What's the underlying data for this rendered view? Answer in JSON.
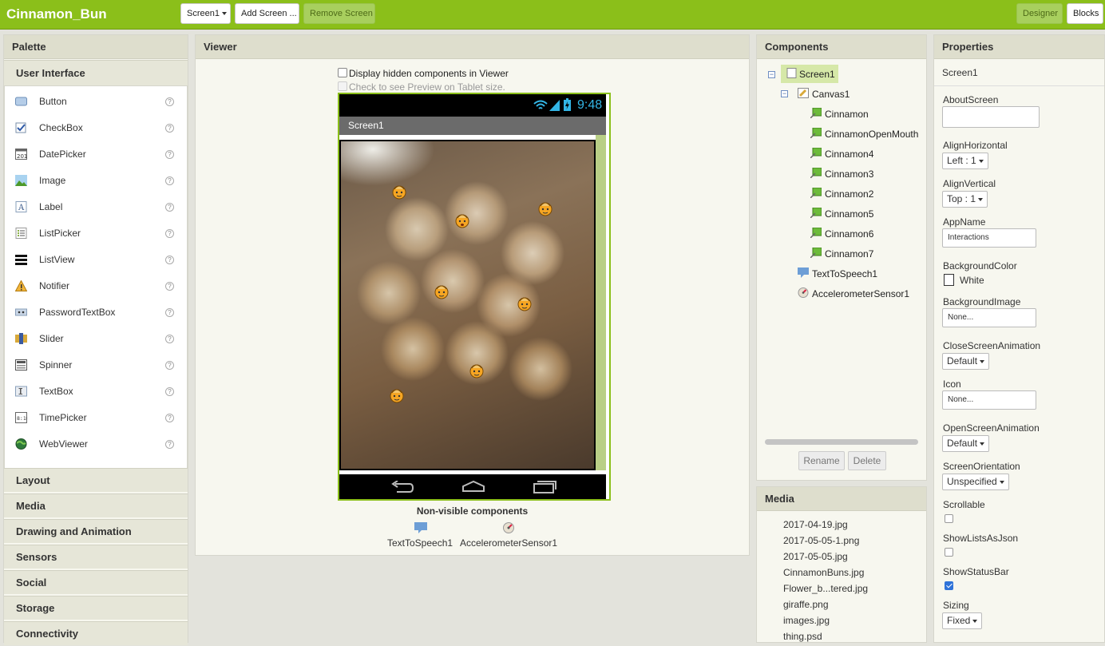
{
  "app_title": "Cinnamon_Bun",
  "toolbar": {
    "screen_select": "Screen1",
    "add_screen": "Add Screen ...",
    "remove_screen": "Remove Screen",
    "designer": "Designer",
    "blocks": "Blocks"
  },
  "palette": {
    "title": "Palette",
    "open_category": "User Interface",
    "items": [
      {
        "label": "Button",
        "icon": "button-icon"
      },
      {
        "label": "CheckBox",
        "icon": "checkbox-icon"
      },
      {
        "label": "DatePicker",
        "icon": "datepicker-icon"
      },
      {
        "label": "Image",
        "icon": "image-icon"
      },
      {
        "label": "Label",
        "icon": "label-icon"
      },
      {
        "label": "ListPicker",
        "icon": "listpicker-icon"
      },
      {
        "label": "ListView",
        "icon": "listview-icon"
      },
      {
        "label": "Notifier",
        "icon": "notifier-icon"
      },
      {
        "label": "PasswordTextBox",
        "icon": "passwordtextbox-icon"
      },
      {
        "label": "Slider",
        "icon": "slider-icon"
      },
      {
        "label": "Spinner",
        "icon": "spinner-icon"
      },
      {
        "label": "TextBox",
        "icon": "textbox-icon"
      },
      {
        "label": "TimePicker",
        "icon": "timepicker-icon"
      },
      {
        "label": "WebViewer",
        "icon": "webviewer-icon"
      }
    ],
    "help_mark": "?",
    "categories": [
      "Layout",
      "Media",
      "Drawing and Animation",
      "Sensors",
      "Social",
      "Storage",
      "Connectivity"
    ]
  },
  "viewer": {
    "title": "Viewer",
    "hidden_checkbox_label": "Display hidden components in Viewer",
    "tablet_checkbox_label": "Check to see Preview on Tablet size.",
    "status_time": "9:48",
    "screen_title": "Screen1",
    "nonvisible_title": "Non-visible components",
    "nonvisible": [
      "TextToSpeech1",
      "AccelerometerSensor1"
    ]
  },
  "components": {
    "title": "Components",
    "screen": "Screen1",
    "canvas": "Canvas1",
    "sprites": [
      "Cinnamon",
      "CinnamonOpenMouth",
      "Cinnamon4",
      "Cinnamon3",
      "Cinnamon2",
      "Cinnamon5",
      "Cinnamon6",
      "Cinnamon7"
    ],
    "tts": "TextToSpeech1",
    "accel": "AccelerometerSensor1",
    "rename": "Rename",
    "delete": "Delete"
  },
  "media": {
    "title": "Media",
    "files": [
      "2017-04-19.jpg",
      "2017-05-05-1.png",
      "2017-05-05.jpg",
      "CinnamonBuns.jpg",
      "Flower_b...tered.jpg",
      "giraffe.png",
      "images.jpg",
      "thing.psd"
    ]
  },
  "properties": {
    "title": "Properties",
    "component": "Screen1",
    "about_screen_label": "AboutScreen",
    "about_screen_value": "",
    "align_horizontal_label": "AlignHorizontal",
    "align_horizontal_value": "Left : 1",
    "align_vertical_label": "AlignVertical",
    "align_vertical_value": "Top : 1",
    "app_name_label": "AppName",
    "app_name_value": "Interactions",
    "bg_color_label": "BackgroundColor",
    "bg_color_value": "White",
    "bg_image_label": "BackgroundImage",
    "bg_image_value": "None...",
    "close_anim_label": "CloseScreenAnimation",
    "close_anim_value": "Default",
    "icon_label": "Icon",
    "icon_value": "None...",
    "open_anim_label": "OpenScreenAnimation",
    "open_anim_value": "Default",
    "orientation_label": "ScreenOrientation",
    "orientation_value": "Unspecified",
    "scrollable_label": "Scrollable",
    "scrollable_checked": false,
    "showlists_label": "ShowListsAsJson",
    "showlists_checked": false,
    "showstatus_label": "ShowStatusBar",
    "showstatus_checked": true,
    "sizing_label": "Sizing",
    "sizing_value": "Fixed"
  },
  "colors": {
    "brand_green": "#8bbf1a",
    "panel_bg": "#f7f7ef",
    "selected_bg": "#d6e8a8"
  }
}
